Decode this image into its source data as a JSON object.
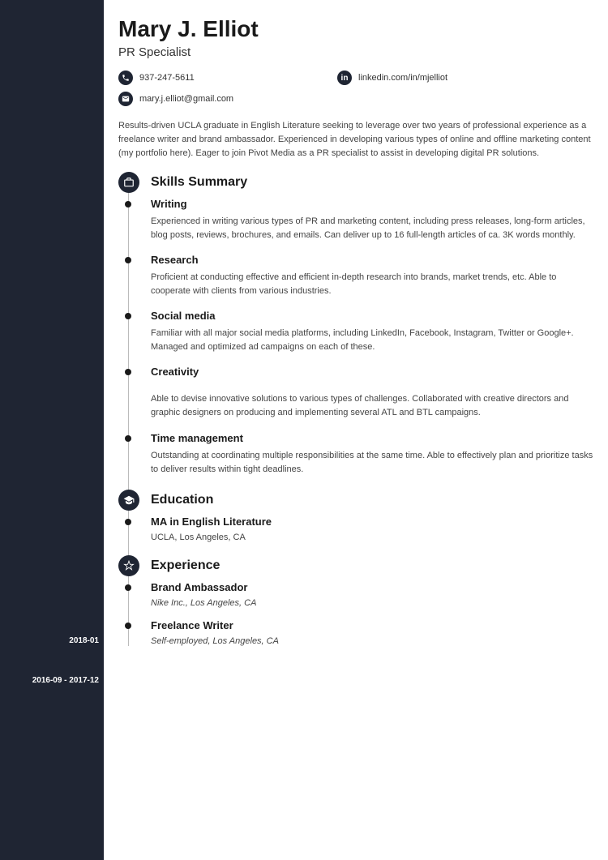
{
  "header": {
    "name": "Mary J. Elliot",
    "title": "PR Specialist"
  },
  "contacts": {
    "phone": "937-247-5611",
    "linkedin": "linkedin.com/in/mjelliot",
    "email": "mary.j.elliot@gmail.com"
  },
  "summary": "Results-driven UCLA graduate in English Literature seeking to leverage over two years of professional experience as a freelance writer and brand ambassador. Experienced in developing various types of online and offline marketing content (my portfolio here). Eager to join Pivot Media as a PR specialist to assist in developing digital PR solutions.",
  "sections": {
    "skills": {
      "heading": "Skills Summary",
      "items": [
        {
          "title": "Writing",
          "body": "Experienced in writing various types of PR and marketing content, including press releases, long-form articles, blog posts, reviews, brochures, and emails. Can deliver up to 16 full-length articles of ca. 3K words monthly."
        },
        {
          "title": "Research",
          "body": "Proficient at conducting effective and efficient in-depth research into brands, market trends, etc. Able to cooperate with clients from various industries."
        },
        {
          "title": "Social media",
          "body": "Familiar with all major social media platforms, including LinkedIn, Facebook, Instagram, Twitter or Google+. Managed and optimized ad campaigns on each of these."
        },
        {
          "title": "Creativity",
          "body": "Able to devise innovative solutions to various types of challenges. Collaborated with creative directors and graphic designers on producing and implementing several ATL and BTL campaigns."
        },
        {
          "title": "Time management",
          "body": "Outstanding at coordinating multiple responsibilities at the same time. Able to effectively plan and prioritize tasks to deliver results within tight deadlines."
        }
      ]
    },
    "education": {
      "heading": "Education",
      "items": [
        {
          "title": "MA in English Literature",
          "sub": "UCLA, Los Angeles, CA"
        }
      ]
    },
    "experience": {
      "heading": "Experience",
      "items": [
        {
          "date": "2018-01",
          "title": "Brand Ambassador",
          "sub": "Nike Inc., Los Angeles, CA"
        },
        {
          "date": "2016-09 - 2017-12",
          "title": "Freelance Writer",
          "sub": "Self-employed, Los Angeles, CA"
        }
      ]
    }
  }
}
